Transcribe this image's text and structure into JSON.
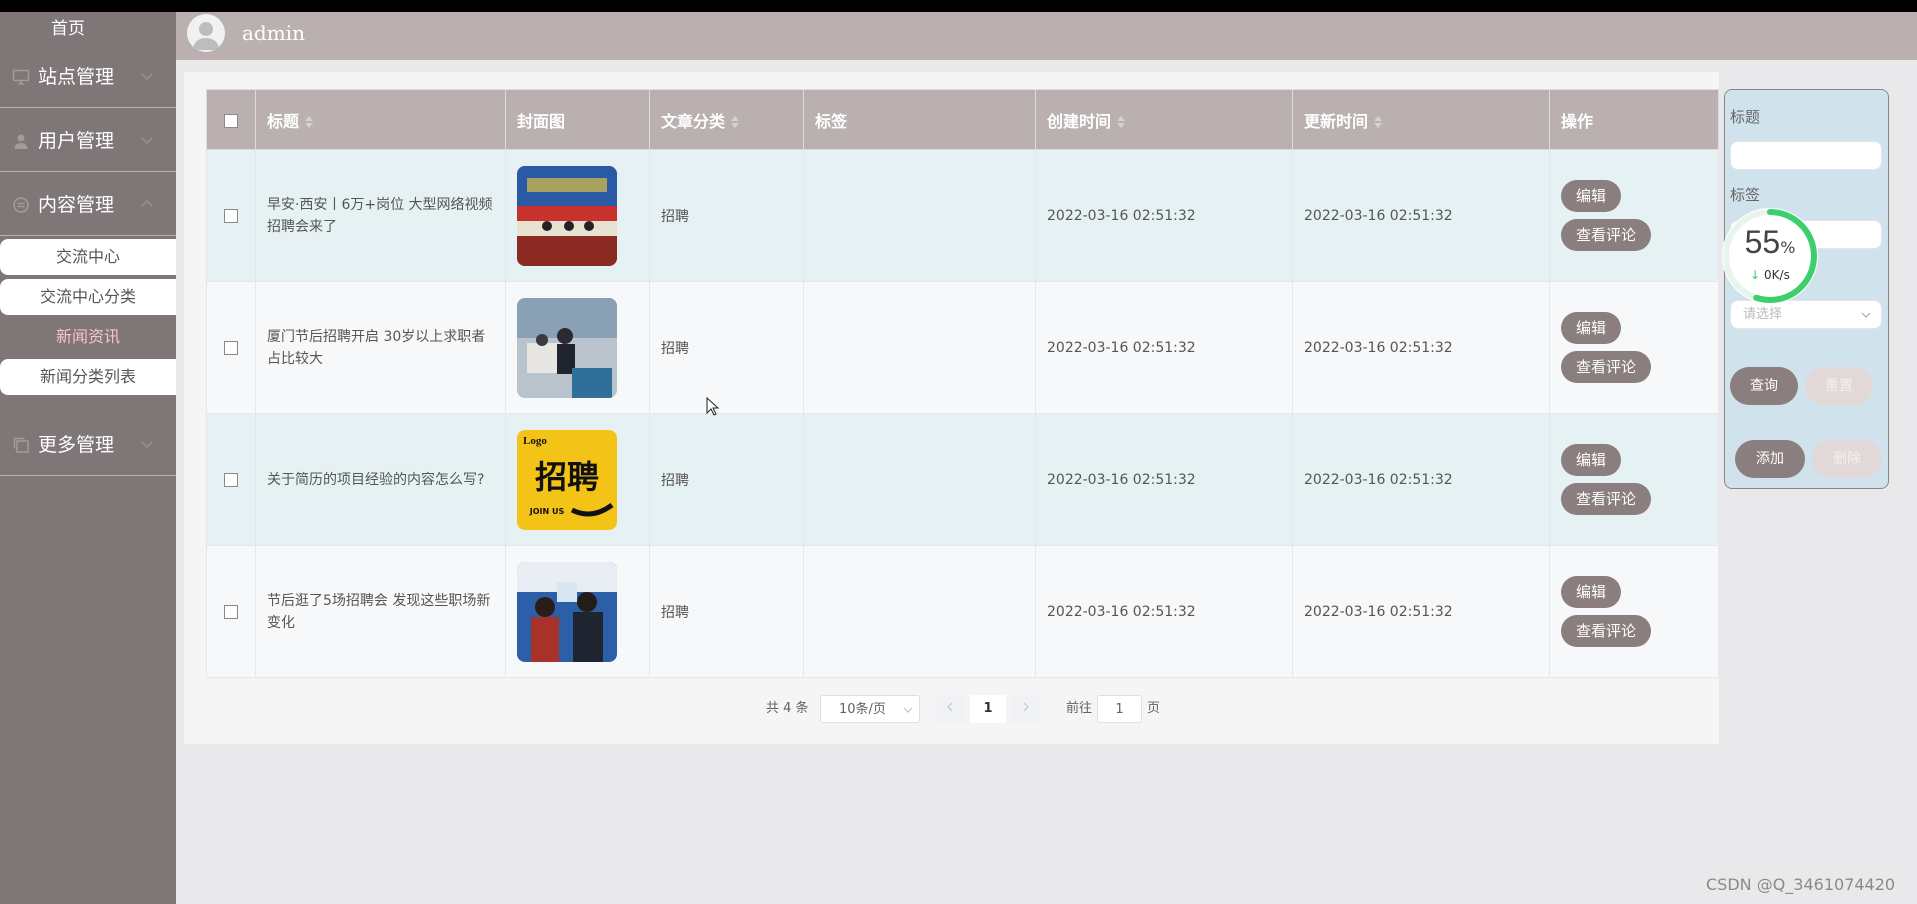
{
  "sidebar": {
    "home": "首页",
    "groups": [
      {
        "label": "站点管理",
        "icon": "monitor-icon"
      },
      {
        "label": "用户管理",
        "icon": "user-icon"
      },
      {
        "label": "内容管理",
        "icon": "content-icon"
      },
      {
        "label": "更多管理",
        "icon": "copy-icon"
      }
    ],
    "subitems": [
      "交流中心",
      "交流中心分类",
      "新闻资讯",
      "新闻分类列表"
    ],
    "active_subitem": "新闻资讯"
  },
  "header": {
    "username": "admin"
  },
  "table": {
    "columns": [
      "标题",
      "封面图",
      "文章分类",
      "标签",
      "创建时间",
      "更新时间",
      "操作"
    ],
    "rows": [
      {
        "title": "早安·西安丨6万+岗位 大型网络视频招聘会来了",
        "category": "招聘",
        "tag": "",
        "created": "2022-03-16 02:51:32",
        "updated": "2022-03-16 02:51:32"
      },
      {
        "title": "厦门节后招聘开启 30岁以上求职者占比较大",
        "category": "招聘",
        "tag": "",
        "created": "2022-03-16 02:51:32",
        "updated": "2022-03-16 02:51:32"
      },
      {
        "title": "关于简历的项目经验的内容怎么写?",
        "category": "招聘",
        "tag": "",
        "created": "2022-03-16 02:51:32",
        "updated": "2022-03-16 02:51:32"
      },
      {
        "title": "节后逛了5场招聘会 发现这些职场新变化",
        "category": "招聘",
        "tag": "",
        "created": "2022-03-16 02:51:32",
        "updated": "2022-03-16 02:51:32"
      }
    ],
    "edit_label": "编辑",
    "comments_label": "查看评论",
    "thumb3_text": {
      "logo": "Logo",
      "main": "招聘",
      "sub": "JOIN US"
    }
  },
  "pager": {
    "total": "共 4 条",
    "page_size": "10条/页",
    "current_page": "1",
    "goto_label": "前往",
    "goto_value": "1",
    "page_suffix": "页"
  },
  "filter": {
    "title_label": "标题",
    "tag_label": "标签",
    "select_placeholder": "请选择",
    "query": "查询",
    "reset": "重置",
    "add": "添加",
    "delete": "删除"
  },
  "speed_widget": {
    "percent": "55",
    "unit": "%",
    "rate": "0K/s",
    "progress": 0.55
  },
  "watermark": "CSDN @Q_3461074420",
  "colors": {
    "sidebar": "#7f7777",
    "header": "#bbb0b0",
    "button": "#8a7f7e",
    "active_sub": "#f7c3c9",
    "filter_bg": "#d0e2ec"
  }
}
